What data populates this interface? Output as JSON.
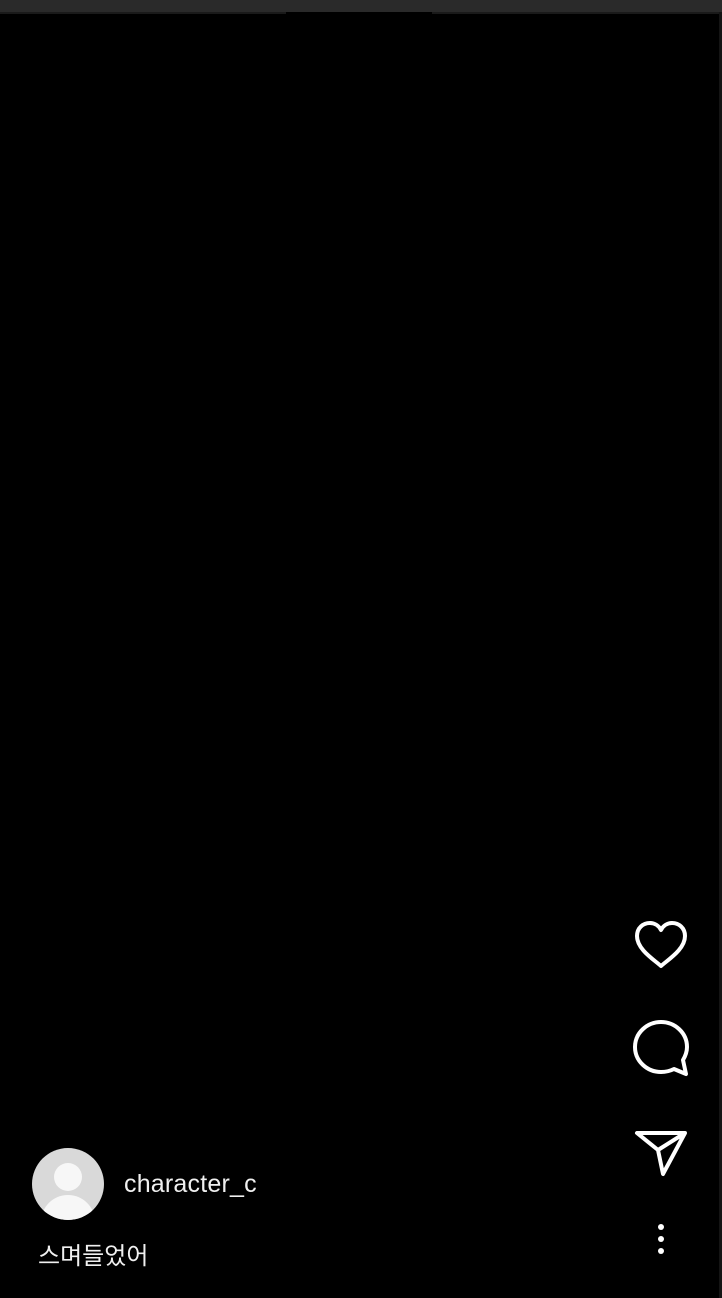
{
  "post": {
    "author": {
      "username": "character_c",
      "avatar_icon": "default-avatar-icon"
    },
    "caption": "스며들었어"
  },
  "actions": {
    "like_icon": "heart-icon",
    "comment_icon": "comment-bubble-icon",
    "share_icon": "paper-plane-icon",
    "more_icon": "vertical-ellipsis-icon"
  },
  "colors": {
    "background": "#000000",
    "foreground": "#ffffff",
    "avatar_bg": "#d9d9d9"
  }
}
